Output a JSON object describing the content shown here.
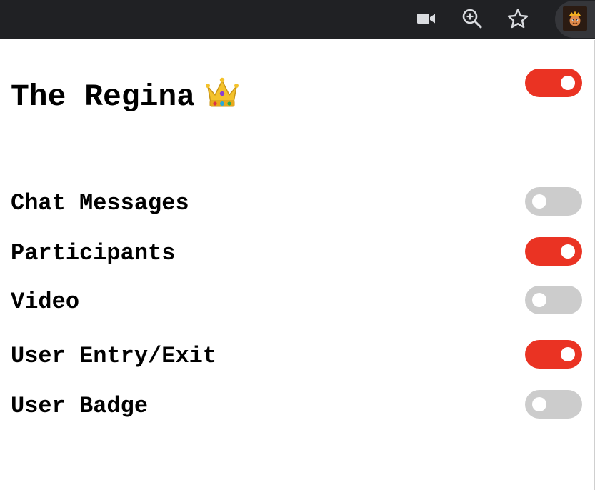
{
  "toolbar": {
    "icons": [
      "video-camera-icon",
      "zoom-in-icon",
      "bookmark-star-icon",
      "extension-avatar-icon"
    ]
  },
  "colors": {
    "toggle_on": "#ea3323",
    "toggle_off": "#cccccc",
    "toolbar_bg": "#202124",
    "toolbar_icon": "#dadce0"
  },
  "header": {
    "title": "The Regina",
    "master_toggle_on": true
  },
  "settings": [
    {
      "label": "Chat Messages",
      "on": false
    },
    {
      "label": "Participants",
      "on": true
    },
    {
      "label": "Video",
      "on": false
    },
    {
      "label": "User Entry/Exit",
      "on": true
    },
    {
      "label": "User Badge",
      "on": false
    }
  ]
}
